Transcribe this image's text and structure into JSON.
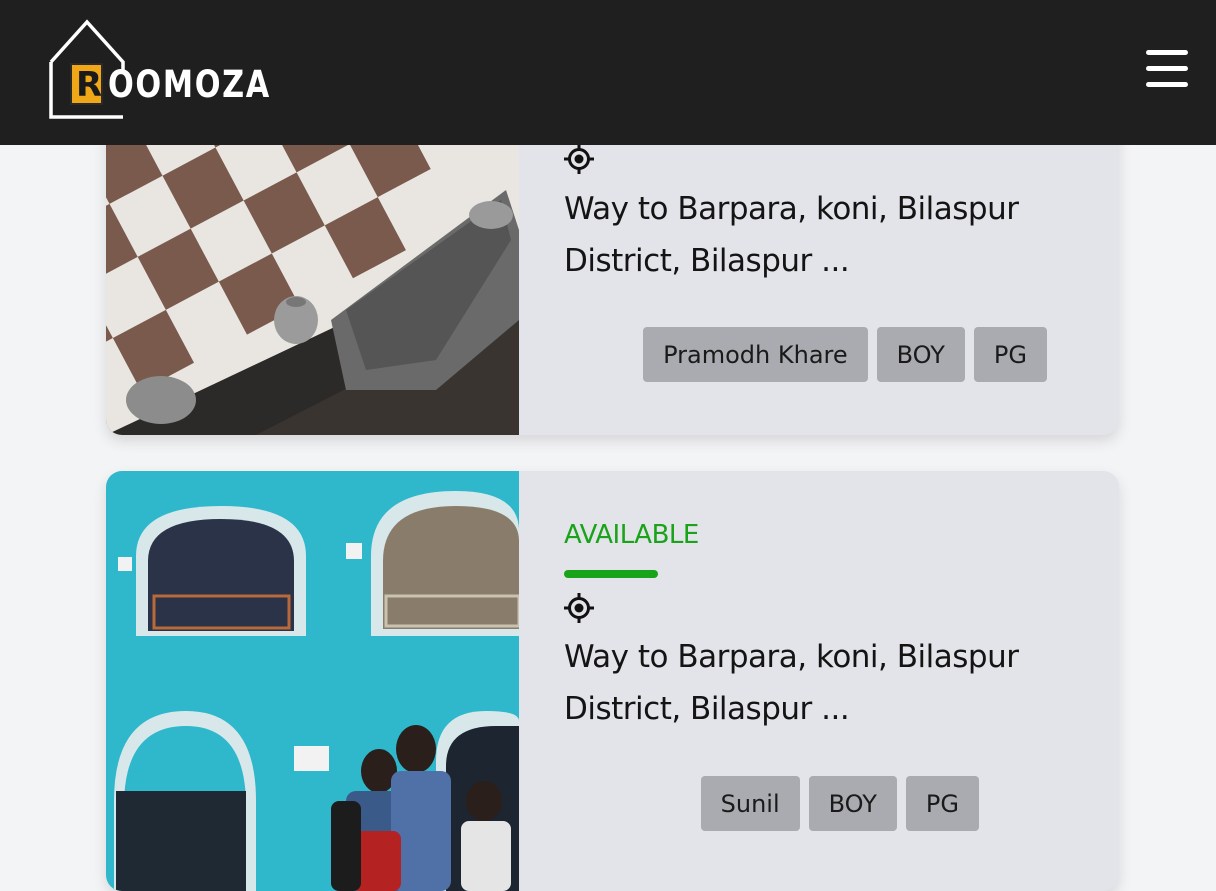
{
  "header": {
    "logo_text": "OOMOZA",
    "logo_letter": "R",
    "menu_icon": "hamburger-menu-icon",
    "colors": {
      "background": "#1f1f1f",
      "logo_accent": "#f0a818"
    }
  },
  "listings": [
    {
      "address": "Way to Barpara, koni, Bilaspur District, Bilaspur ...",
      "tags": [
        "Pramodh Khare",
        "BOY",
        "PG"
      ],
      "location_icon": "location-target-icon"
    },
    {
      "status": "AVAILABLE",
      "address": "Way to Barpara, koni, Bilaspur District, Bilaspur ...",
      "tags": [
        "Sunil",
        "BOY",
        "PG"
      ],
      "location_icon": "location-target-icon"
    }
  ],
  "colors": {
    "available": "#19a319",
    "card_bg": "#e2e4e9",
    "tag_bg": "#a9abb0"
  }
}
